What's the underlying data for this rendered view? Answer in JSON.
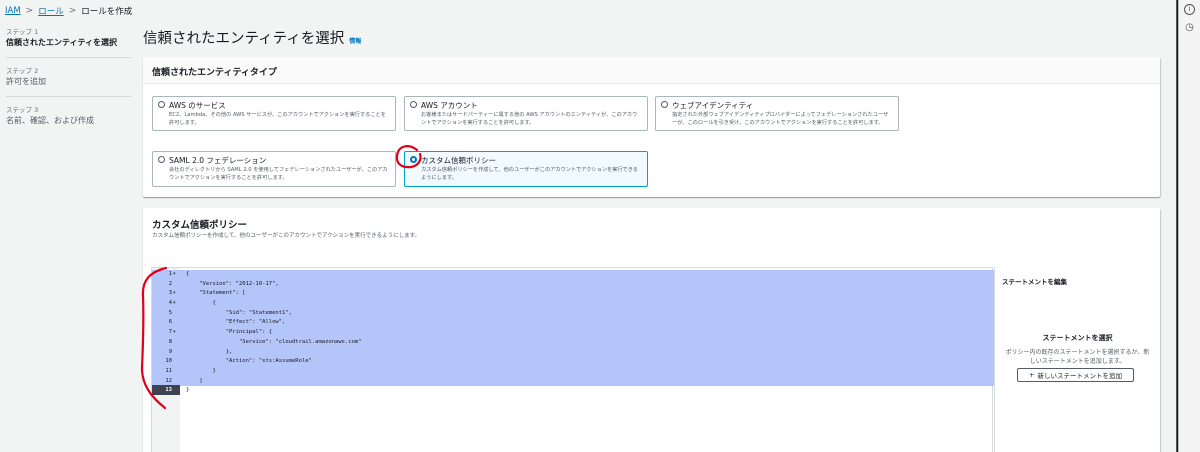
{
  "breadcrumb": {
    "iam": "IAM",
    "roles": "ロール",
    "current": "ロールを作成",
    "sep": ">"
  },
  "steps": [
    {
      "num": "ステップ 1",
      "label": "信頼されたエンティティを選択"
    },
    {
      "num": "ステップ 2",
      "label": "許可を追加"
    },
    {
      "num": "ステップ 3",
      "label": "名前、確認、および作成"
    }
  ],
  "page": {
    "title": "信頼されたエンティティを選択",
    "info": "情報"
  },
  "entity_panel": {
    "title": "信頼されたエンティティタイプ",
    "tiles": [
      {
        "title": "AWS のサービス",
        "desc": "EC2、Lambda、その他の AWS サービスが、このアカウントでアクションを実行することを許可します。"
      },
      {
        "title": "AWS アカウント",
        "desc": "お客様またはサードパーティーに属する他の AWS アカウントのエンティティが、このアカウントでアクションを実行することを許可します。"
      },
      {
        "title": "ウェブアイデンティティ",
        "desc": "指定された外部ウェブアイデンティティプロバイダーによってフェデレーションされたユーザーが、このロールを引き受け、このアカウントでアクションを実行することを許可します。"
      },
      {
        "title": "SAML 2.0 フェデレーション",
        "desc": "会社のディレクトリから SAML 2.0 を使用してフェデレーションされたユーザーが、このアカウントでアクションを実行することを許可します。"
      },
      {
        "title": "カスタム信頼ポリシー",
        "desc": "カスタム信頼ポリシーを作成して、他のユーザーがこのアカウントでアクションを実行できるようにします。"
      }
    ]
  },
  "policy_panel": {
    "title": "カスタム信頼ポリシー",
    "desc": "カスタム信頼ポリシーを作成して、他のユーザーがこのアカウントでアクションを実行できるようにします。"
  },
  "editor": {
    "lines": [
      {
        "n": "1",
        "code": "{"
      },
      {
        "n": "2",
        "code": "    \"Version\": \"2012-10-17\","
      },
      {
        "n": "3",
        "code": "    \"Statement\": ["
      },
      {
        "n": "4",
        "code": "        {"
      },
      {
        "n": "5",
        "code": "            \"Sid\": \"Statement1\","
      },
      {
        "n": "6",
        "code": "            \"Effect\": \"Allow\","
      },
      {
        "n": "7",
        "code": "            \"Principal\": {"
      },
      {
        "n": "8",
        "code": "                \"Service\": \"cloudtrail.amazonaws.com\""
      },
      {
        "n": "9",
        "code": "            },"
      },
      {
        "n": "10",
        "code": "            \"Action\": \"sts:AssumeRole\""
      },
      {
        "n": "11",
        "code": "        }"
      },
      {
        "n": "12",
        "code": "    ]"
      },
      {
        "n": "13",
        "code": "}"
      }
    ],
    "fold_glyph": "▼"
  },
  "side": {
    "header": "ステートメントを編集",
    "title": "ステートメントを選択",
    "desc": "ポリシー内の既存のステートメントを選択するか、新しいステートメントを追加します。",
    "add_icon": "+",
    "add_label": "新しいステートメントを追加"
  },
  "right_strip": {
    "top_icon": "i",
    "second_icon": "◷"
  },
  "colors": {
    "link": "#0073bb",
    "selection": "#b4c5f9",
    "annotation": "#e0001b"
  }
}
